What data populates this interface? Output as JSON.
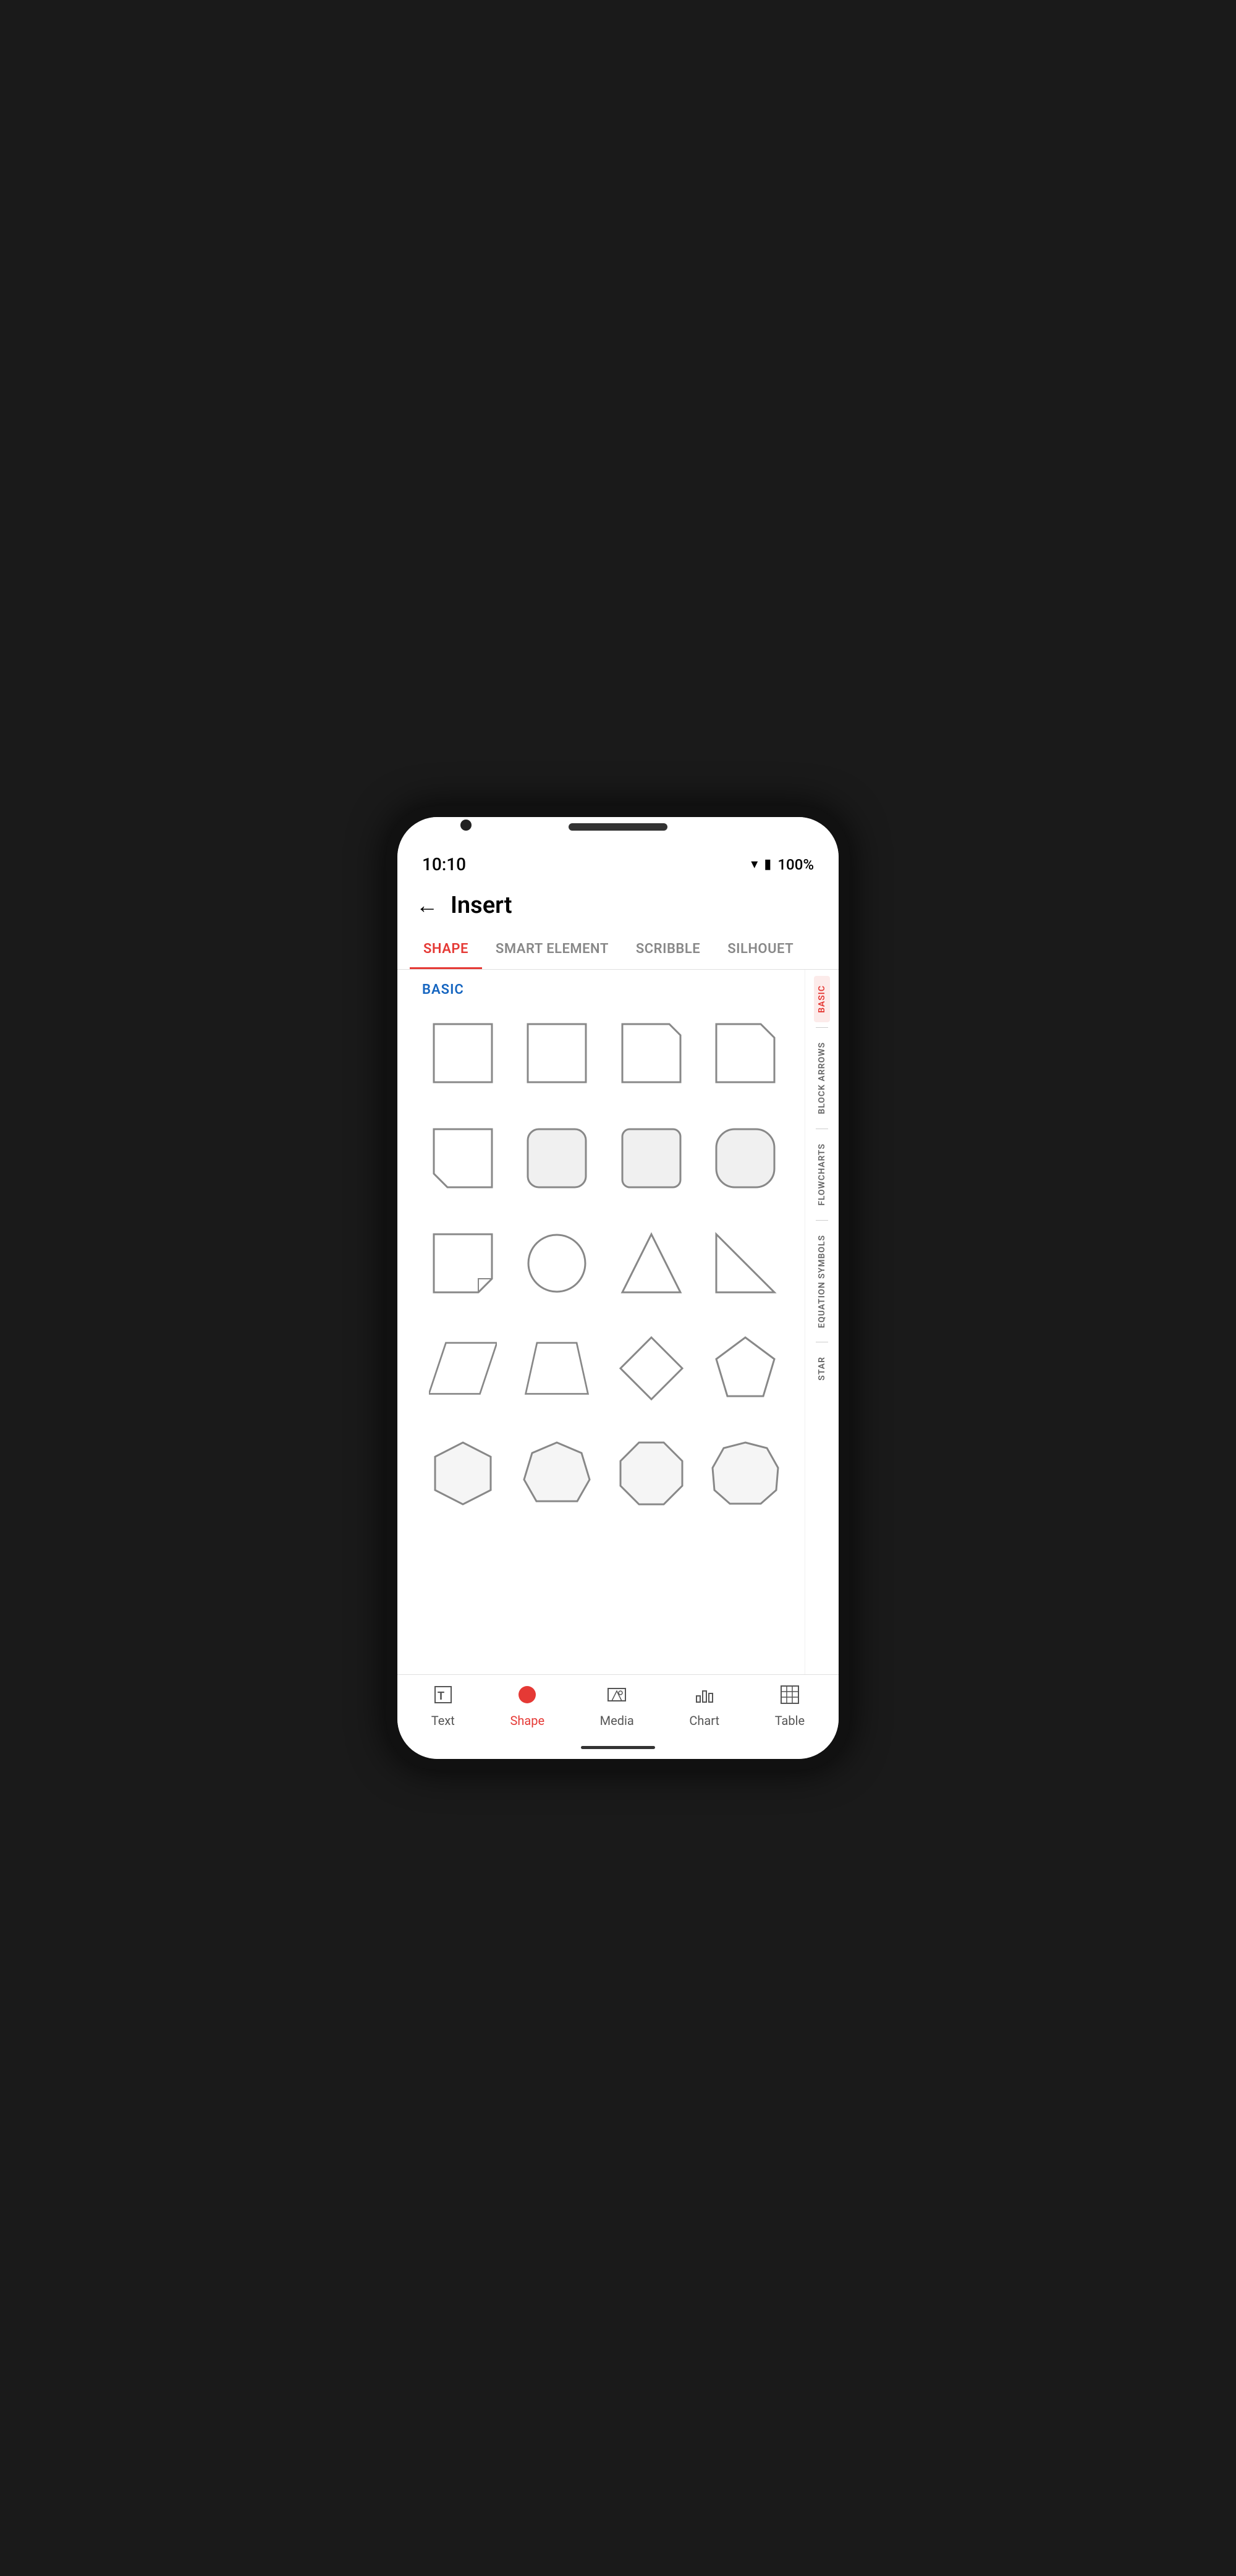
{
  "status": {
    "time": "10:10",
    "battery": "100%"
  },
  "header": {
    "title": "Insert",
    "back_label": "←"
  },
  "tabs": [
    {
      "id": "shape",
      "label": "SHAPE",
      "active": true
    },
    {
      "id": "smart-element",
      "label": "SMART ELEMENT",
      "active": false
    },
    {
      "id": "scribble",
      "label": "SCRIBBLE",
      "active": false
    },
    {
      "id": "silhouette",
      "label": "SILHOUET",
      "active": false
    }
  ],
  "section_label": "BASIC",
  "side_index": [
    {
      "label": "BASIC",
      "active": true
    },
    {
      "label": "BLOCK ARROWS",
      "active": false
    },
    {
      "label": "FLOWCHARTS",
      "active": false
    },
    {
      "label": "EQUATION SYMBOLS",
      "active": false
    },
    {
      "label": "STAR",
      "active": false
    }
  ],
  "bottom_nav": [
    {
      "id": "text",
      "label": "Text",
      "active": false,
      "icon": "T"
    },
    {
      "id": "shape",
      "label": "Shape",
      "active": true,
      "icon": "shape"
    },
    {
      "id": "media",
      "label": "Media",
      "active": false,
      "icon": "media"
    },
    {
      "id": "chart",
      "label": "Chart",
      "active": false,
      "icon": "chart"
    },
    {
      "id": "table",
      "label": "Table",
      "active": false,
      "icon": "table"
    }
  ],
  "accent_color": "#e53935",
  "tab_active_color": "#e53935",
  "section_color": "#1565C0"
}
